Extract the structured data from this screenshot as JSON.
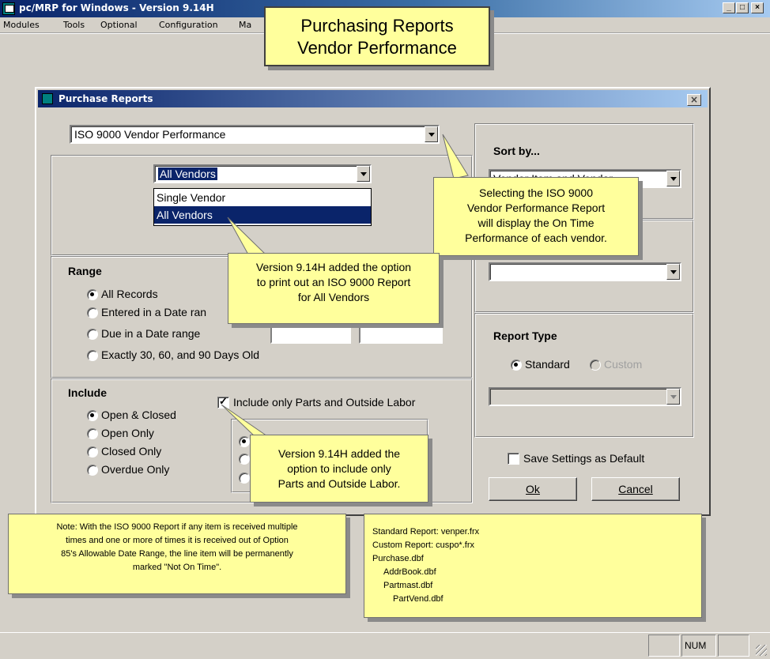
{
  "window": {
    "title": "pc/MRP for Windows - Version 9.14H",
    "minimize": "_",
    "maximize": "□",
    "close": "×"
  },
  "menu": [
    "Modules",
    "Tools",
    "Optional",
    "Configuration",
    "Ma"
  ],
  "dialog": {
    "title": "Purchase Reports",
    "close": "×",
    "report_select": "ISO 9000 Vendor Performance",
    "vendor_select": "All Vendors",
    "vendor_options": [
      "Single Vendor",
      "All Vendors"
    ],
    "range": {
      "title": "Range",
      "options": [
        "All Records",
        "Entered in a Date ran",
        "Due in a Date range",
        "Exactly 30, 60, and 90 Days Old"
      ]
    },
    "include": {
      "title": "Include",
      "options": [
        "Open & Closed",
        "Open Only",
        "Closed Only",
        "Overdue Only"
      ],
      "only_parts": "Include only Parts and Outside Labor"
    },
    "sort_by": "Sort by...",
    "sort_select": "Vendor Item and Vendor",
    "report_type": {
      "title": "Report Type",
      "standard": "Standard",
      "custom": "Custom"
    },
    "save_default": "Save Settings as Default",
    "ok": "Ok",
    "cancel": "Cancel"
  },
  "callouts": {
    "heading": [
      "Purchasing Reports",
      "Vendor Performance"
    ],
    "iso_report": [
      "Selecting the ISO 9000",
      "Vendor Performance Report",
      "will display the On Time",
      "Performance of each vendor."
    ],
    "all_vendors": [
      "Version 9.14H added the option",
      "to print out an ISO 9000 Report",
      "for All Vendors"
    ],
    "parts_only": [
      "Version 9.14H added the",
      "option to include only",
      "Parts and Outside Labor."
    ],
    "note": [
      "Note: With the ISO 9000 Report if any item is received multiple",
      "times and one or more of times it is received out of Option",
      "85's Allowable Date Range, the line item will be permanently",
      "marked  \"Not On Time\"."
    ],
    "files": [
      "Standard Report:  venper.frx",
      "Custom Report:    cuspo*.frx",
      "Purchase.dbf",
      "AddrBook.dbf",
      "Partmast.dbf",
      "PartVend.dbf"
    ]
  },
  "status": {
    "num": "NUM"
  }
}
